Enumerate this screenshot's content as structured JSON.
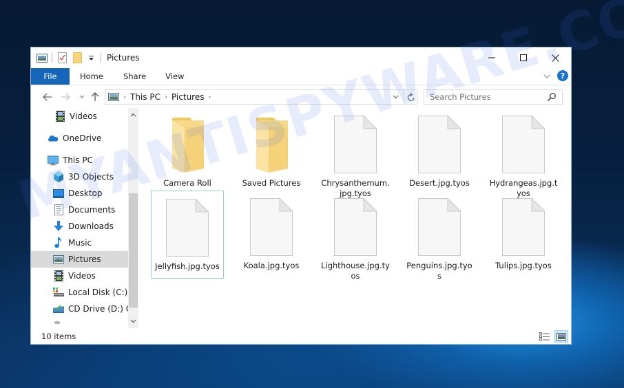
{
  "window": {
    "title": "Pictures",
    "controls": {
      "minimize": "minimize",
      "maximize": "maximize",
      "close": "close"
    }
  },
  "quick_access_toolbar": {
    "icons": [
      "window-icon",
      "properties-check-icon",
      "new-folder-icon",
      "customize-dropdown-icon"
    ]
  },
  "ribbon": {
    "tabs": [
      {
        "label": "File",
        "active": true
      },
      {
        "label": "Home"
      },
      {
        "label": "Share"
      },
      {
        "label": "View"
      }
    ],
    "help_label": "?"
  },
  "navigation": {
    "breadcrumb": [
      "This PC",
      "Pictures"
    ],
    "search": {
      "placeholder": "Search Pictures",
      "value": ""
    }
  },
  "sidebar": {
    "items": [
      {
        "label": "Videos",
        "icon": "videos-icon",
        "indent": 1
      },
      {
        "label": "OneDrive",
        "icon": "onedrive-icon",
        "indent": 0
      },
      {
        "label": "This PC",
        "icon": "this-pc-icon",
        "indent": 0
      },
      {
        "label": "3D Objects",
        "icon": "3d-objects-icon",
        "indent": 1
      },
      {
        "label": "Desktop",
        "icon": "desktop-icon",
        "indent": 1
      },
      {
        "label": "Documents",
        "icon": "documents-icon",
        "indent": 1
      },
      {
        "label": "Downloads",
        "icon": "downloads-icon",
        "indent": 1
      },
      {
        "label": "Music",
        "icon": "music-icon",
        "indent": 1
      },
      {
        "label": "Pictures",
        "icon": "pictures-icon",
        "indent": 1,
        "selected": true
      },
      {
        "label": "Videos",
        "icon": "videos-icon",
        "indent": 1
      },
      {
        "label": "Local Disk (C:)",
        "icon": "local-disk-icon",
        "indent": 1
      },
      {
        "label": "CD Drive (D:) CC",
        "icon": "cd-drive-icon",
        "indent": 1
      }
    ]
  },
  "files": [
    {
      "name": "Camera Roll",
      "type": "folder"
    },
    {
      "name": "Saved Pictures",
      "type": "folder"
    },
    {
      "name": "Chrysanthemum.jpg.tyos",
      "type": "file"
    },
    {
      "name": "Desert.jpg.tyos",
      "type": "file"
    },
    {
      "name": "Hydrangeas.jpg.tyos",
      "type": "file"
    },
    {
      "name": "Jellyfish.jpg.tyos",
      "type": "file",
      "focused": true
    },
    {
      "name": "Koala.jpg.tyos",
      "type": "file"
    },
    {
      "name": "Lighthouse.jpg.tyos",
      "type": "file"
    },
    {
      "name": "Penguins.jpg.tyos",
      "type": "file"
    },
    {
      "name": "Tulips.jpg.tyos",
      "type": "file"
    }
  ],
  "status_bar": {
    "item_count": "10 items",
    "view_modes": [
      "details-view",
      "large-icons-view"
    ],
    "active_view": "large-icons-view"
  },
  "watermark": "MYANTISPYWARE.COM",
  "colors": {
    "file_tab": "#1565b8",
    "selected_nav": "#d9d9d9",
    "focus_border": "#99c9ef",
    "folder": "#f5d37a"
  }
}
